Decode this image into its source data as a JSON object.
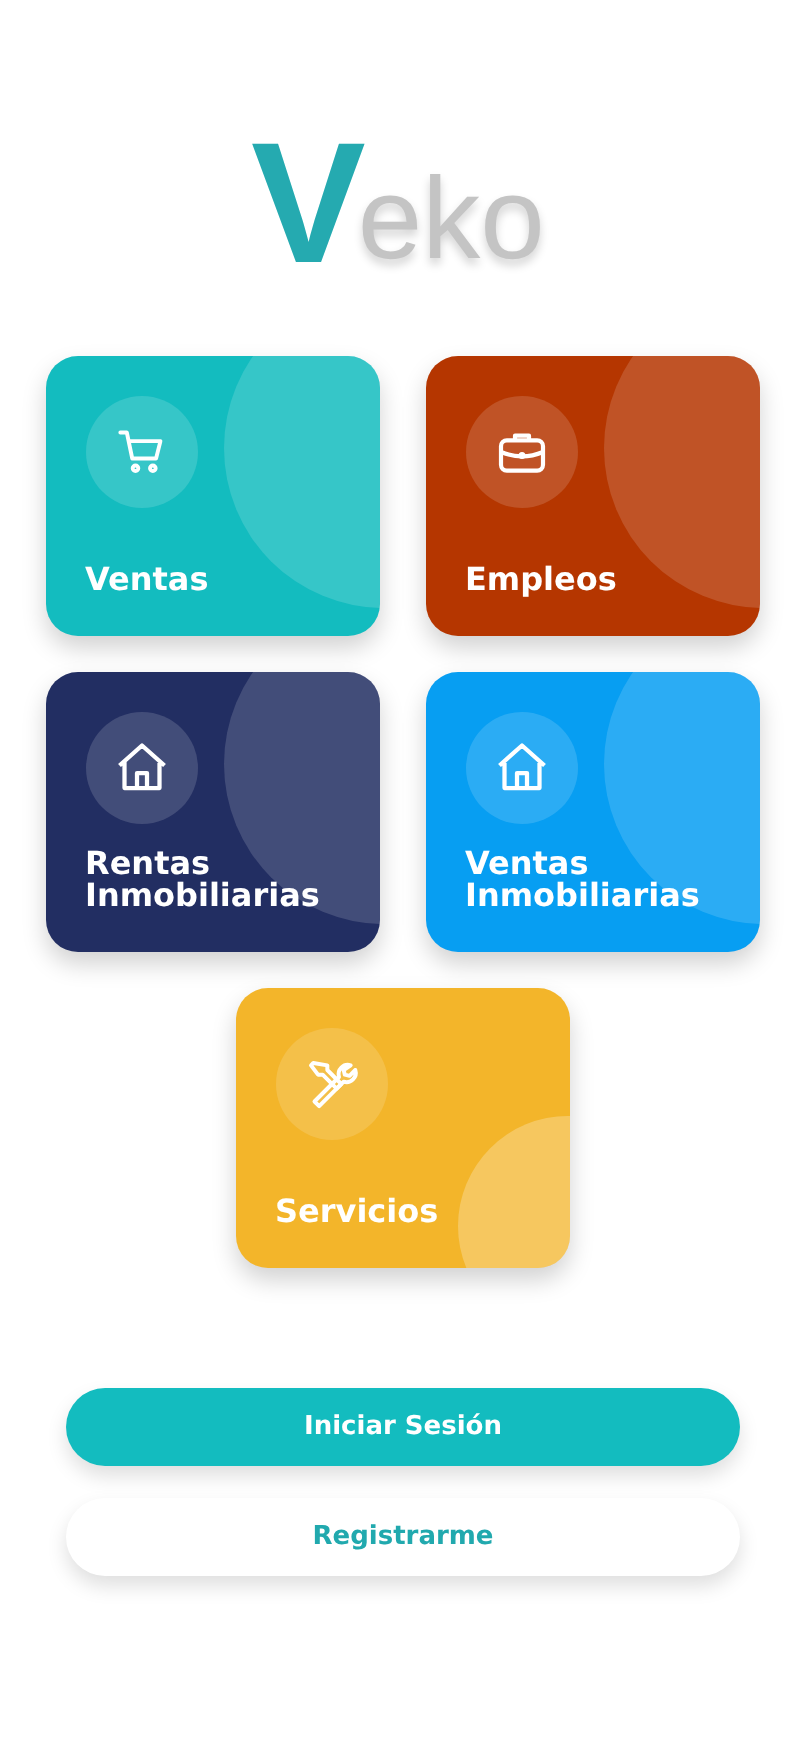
{
  "logo": {
    "initial": "V",
    "rest": "eko"
  },
  "cards": [
    {
      "label": "Ventas",
      "color": "#13bcbf"
    },
    {
      "label": "Empleos",
      "color": "#b53600"
    },
    {
      "label": "Rentas Inmobiliarias",
      "color": "#222e62"
    },
    {
      "label": "Ventas Inmobiliarias",
      "color": "#079ef2"
    },
    {
      "label": "Servicios",
      "color": "#f3b52a"
    }
  ],
  "buttons": [
    {
      "label": "Iniciar Sesión",
      "kind": "primary"
    },
    {
      "label": "Registrarme",
      "kind": "secondary"
    }
  ]
}
